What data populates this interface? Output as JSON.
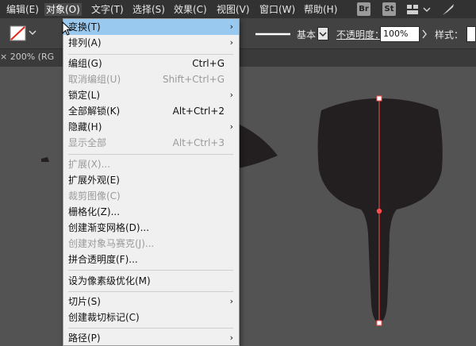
{
  "menubar": {
    "items": [
      {
        "label": "编辑(E)"
      },
      {
        "label": "对象(O)"
      },
      {
        "label": "文字(T)"
      },
      {
        "label": "选择(S)"
      },
      {
        "label": "效果(C)"
      },
      {
        "label": "视图(V)"
      },
      {
        "label": "窗口(W)"
      },
      {
        "label": "帮助(H)"
      }
    ],
    "br_badge": "Br",
    "st_badge": "St"
  },
  "toolbar": {
    "stroke_style": "基本",
    "opacity_label": "不透明度：",
    "opacity_value": "100%",
    "style_label": "样式："
  },
  "tab": {
    "label": "200% (RG"
  },
  "menu": {
    "items": [
      {
        "label": "变换(T)",
        "shortcut": "",
        "submenu": true,
        "disabled": false,
        "highlighted": true
      },
      {
        "label": "排列(A)",
        "shortcut": "",
        "submenu": true,
        "disabled": false
      },
      {
        "label": "编组(G)",
        "shortcut": "Ctrl+G",
        "submenu": false,
        "disabled": false
      },
      {
        "label": "取消编组(U)",
        "shortcut": "Shift+Ctrl+G",
        "submenu": false,
        "disabled": true
      },
      {
        "label": "锁定(L)",
        "shortcut": "",
        "submenu": true,
        "disabled": false
      },
      {
        "label": "全部解锁(K)",
        "shortcut": "Alt+Ctrl+2",
        "submenu": false,
        "disabled": false
      },
      {
        "label": "隐藏(H)",
        "shortcut": "",
        "submenu": true,
        "disabled": false
      },
      {
        "label": "显示全部",
        "shortcut": "Alt+Ctrl+3",
        "submenu": false,
        "disabled": true
      },
      {
        "label": "扩展(X)...",
        "shortcut": "",
        "submenu": false,
        "disabled": true
      },
      {
        "label": "扩展外观(E)",
        "shortcut": "",
        "submenu": false,
        "disabled": false
      },
      {
        "label": "裁剪图像(C)",
        "shortcut": "",
        "submenu": false,
        "disabled": true
      },
      {
        "label": "栅格化(Z)...",
        "shortcut": "",
        "submenu": false,
        "disabled": false
      },
      {
        "label": "创建渐变网格(D)...",
        "shortcut": "",
        "submenu": false,
        "disabled": false
      },
      {
        "label": "创建对象马赛克(J)...",
        "shortcut": "",
        "submenu": false,
        "disabled": true
      },
      {
        "label": "拼合透明度(F)...",
        "shortcut": "",
        "submenu": false,
        "disabled": false
      },
      {
        "label": "设为像素级优化(M)",
        "shortcut": "",
        "submenu": false,
        "disabled": false
      },
      {
        "label": "切片(S)",
        "shortcut": "",
        "submenu": true,
        "disabled": false
      },
      {
        "label": "创建裁切标记(C)",
        "shortcut": "",
        "submenu": false,
        "disabled": false
      },
      {
        "label": "路径(P)",
        "shortcut": "",
        "submenu": true,
        "disabled": false
      }
    ],
    "submenu_glyph": "›"
  },
  "colors": {
    "menubar_bg": "#323232",
    "menu_bg": "#f0f0f0",
    "menu_highlight": "#99c9ef",
    "canvas_bg": "#535353",
    "shape_fill": "#231f20",
    "path_selection": "#ff4e4e"
  }
}
